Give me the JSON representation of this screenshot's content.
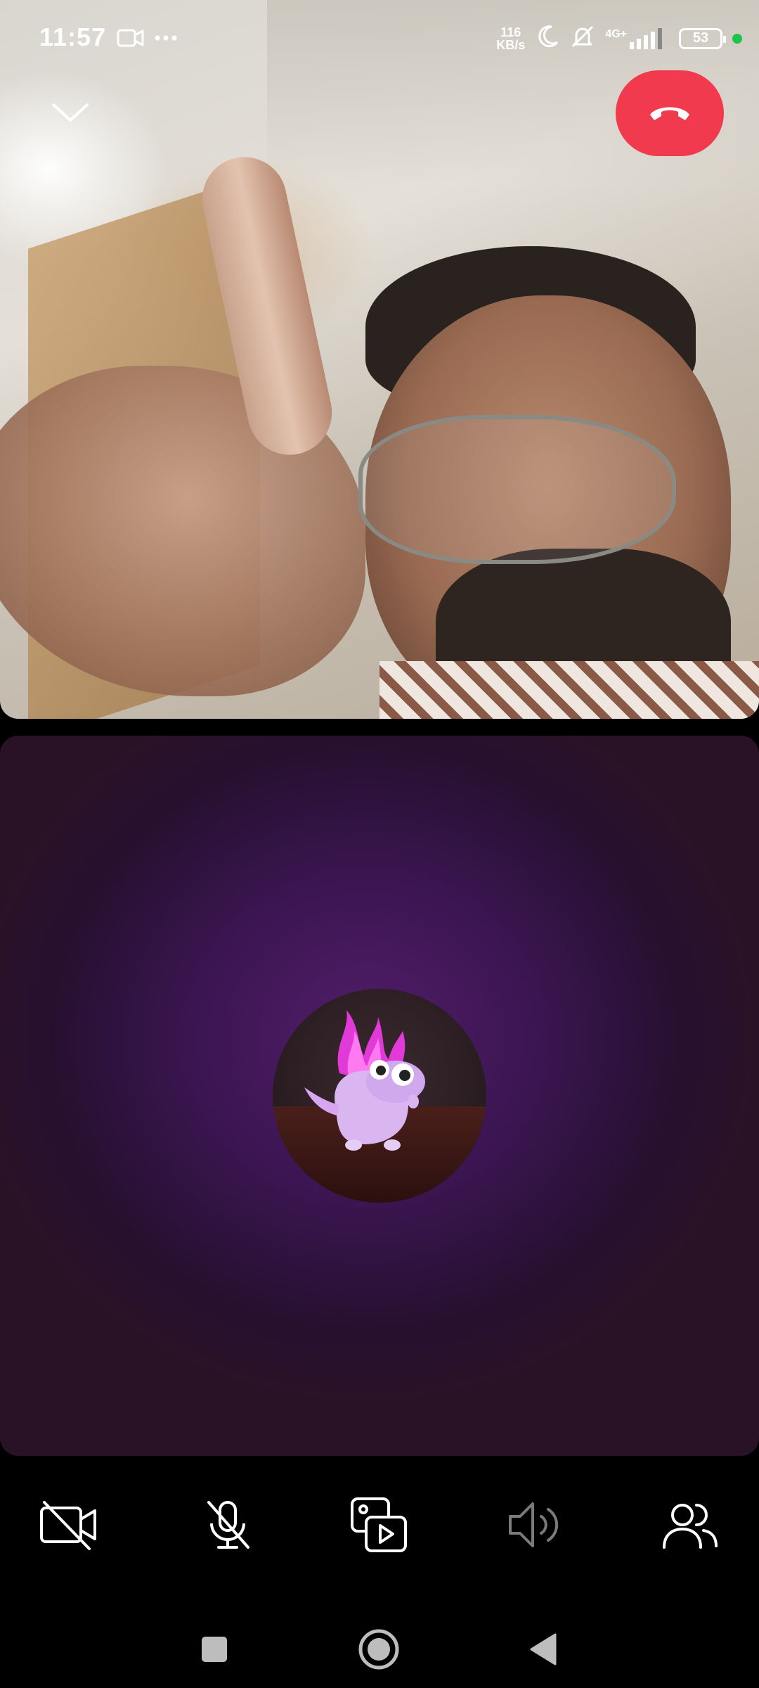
{
  "status_bar": {
    "time": "11:57",
    "net_speed_value": "116",
    "net_speed_unit": "KB/s",
    "network_type": "4G+",
    "battery_level": "53",
    "icons": [
      "video-call-icon",
      "more-dots-icon",
      "moon-icon",
      "bell-off-icon",
      "signal-icon",
      "battery-icon",
      "privacy-dot-icon"
    ]
  },
  "call": {
    "collapse_icon": "chevron-down-icon",
    "end_call_icon": "hang-up-icon",
    "end_call_color": "#f23a4e",
    "local_tile_color": "#3a1550"
  },
  "controls": [
    {
      "name": "camera-toggle",
      "icon": "video-off-icon"
    },
    {
      "name": "mic-toggle",
      "icon": "mic-off-icon"
    },
    {
      "name": "share-media",
      "icon": "media-share-icon"
    },
    {
      "name": "speaker-toggle",
      "icon": "speaker-icon"
    },
    {
      "name": "participants",
      "icon": "people-icon"
    }
  ],
  "nav": [
    "recents-square-icon",
    "home-circle-icon",
    "back-triangle-icon"
  ]
}
